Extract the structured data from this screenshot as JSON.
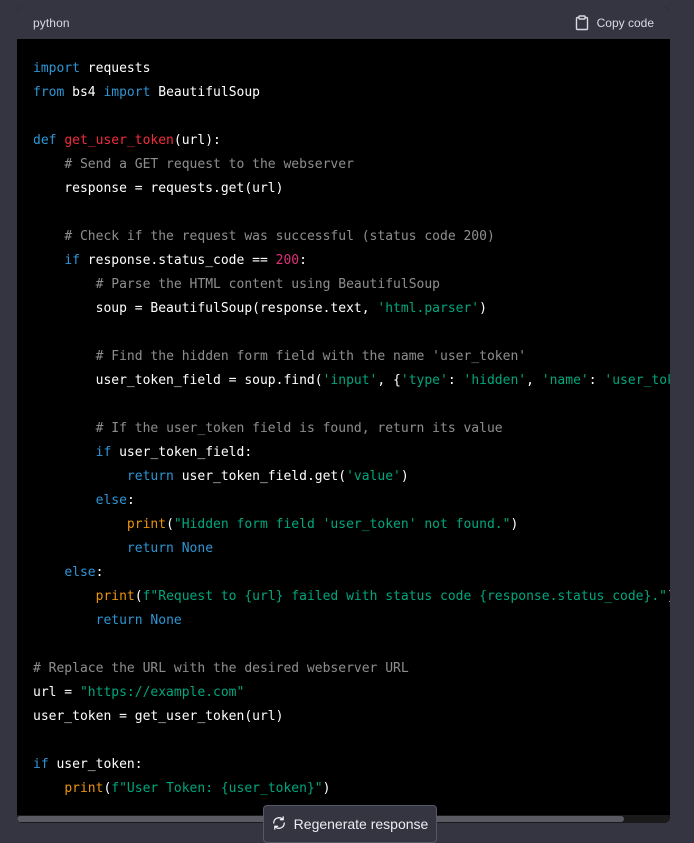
{
  "header": {
    "language": "python",
    "copy_label": "Copy code"
  },
  "footer": {
    "regenerate_label": "Regenerate response"
  },
  "code_lines": [
    [
      {
        "t": "import",
        "c": "kw"
      },
      {
        "t": " requests",
        "c": ""
      }
    ],
    [
      {
        "t": "from",
        "c": "kw"
      },
      {
        "t": " bs4 ",
        "c": ""
      },
      {
        "t": "import",
        "c": "kw"
      },
      {
        "t": " BeautifulSoup",
        "c": ""
      }
    ],
    [],
    [
      {
        "t": "def",
        "c": "kw"
      },
      {
        "t": " ",
        "c": ""
      },
      {
        "t": "get_user_token",
        "c": "fn"
      },
      {
        "t": "(url):",
        "c": ""
      }
    ],
    [
      {
        "t": "    ",
        "c": ""
      },
      {
        "t": "# Send a GET request to the webserver",
        "c": "cm"
      }
    ],
    [
      {
        "t": "    response = requests.get(url)",
        "c": ""
      }
    ],
    [],
    [
      {
        "t": "    ",
        "c": ""
      },
      {
        "t": "# Check if the request was successful (status code 200)",
        "c": "cm"
      }
    ],
    [
      {
        "t": "    ",
        "c": ""
      },
      {
        "t": "if",
        "c": "kw"
      },
      {
        "t": " response.status_code == ",
        "c": ""
      },
      {
        "t": "200",
        "c": "num"
      },
      {
        "t": ":",
        "c": ""
      }
    ],
    [
      {
        "t": "        ",
        "c": ""
      },
      {
        "t": "# Parse the HTML content using BeautifulSoup",
        "c": "cm"
      }
    ],
    [
      {
        "t": "        soup = BeautifulSoup(response.text, ",
        "c": ""
      },
      {
        "t": "'html.parser'",
        "c": "str"
      },
      {
        "t": ")",
        "c": ""
      }
    ],
    [],
    [
      {
        "t": "        ",
        "c": ""
      },
      {
        "t": "# Find the hidden form field with the name 'user_token'",
        "c": "cm"
      }
    ],
    [
      {
        "t": "        user_token_field = soup.find(",
        "c": ""
      },
      {
        "t": "'input'",
        "c": "str"
      },
      {
        "t": ", {",
        "c": ""
      },
      {
        "t": "'type'",
        "c": "str"
      },
      {
        "t": ": ",
        "c": ""
      },
      {
        "t": "'hidden'",
        "c": "str"
      },
      {
        "t": ", ",
        "c": ""
      },
      {
        "t": "'name'",
        "c": "str"
      },
      {
        "t": ": ",
        "c": ""
      },
      {
        "t": "'user_token'",
        "c": "str"
      },
      {
        "t": "})",
        "c": ""
      }
    ],
    [],
    [
      {
        "t": "        ",
        "c": ""
      },
      {
        "t": "# If the user_token field is found, return its value",
        "c": "cm"
      }
    ],
    [
      {
        "t": "        ",
        "c": ""
      },
      {
        "t": "if",
        "c": "kw"
      },
      {
        "t": " user_token_field:",
        "c": ""
      }
    ],
    [
      {
        "t": "            ",
        "c": ""
      },
      {
        "t": "return",
        "c": "kw"
      },
      {
        "t": " user_token_field.get(",
        "c": ""
      },
      {
        "t": "'value'",
        "c": "str"
      },
      {
        "t": ")",
        "c": ""
      }
    ],
    [
      {
        "t": "        ",
        "c": ""
      },
      {
        "t": "else",
        "c": "kw"
      },
      {
        "t": ":",
        "c": ""
      }
    ],
    [
      {
        "t": "            ",
        "c": ""
      },
      {
        "t": "print",
        "c": "bi"
      },
      {
        "t": "(",
        "c": ""
      },
      {
        "t": "\"Hidden form field 'user_token' not found.\"",
        "c": "str"
      },
      {
        "t": ")",
        "c": ""
      }
    ],
    [
      {
        "t": "            ",
        "c": ""
      },
      {
        "t": "return",
        "c": "kw"
      },
      {
        "t": " ",
        "c": ""
      },
      {
        "t": "None",
        "c": "kw"
      }
    ],
    [
      {
        "t": "    ",
        "c": ""
      },
      {
        "t": "else",
        "c": "kw"
      },
      {
        "t": ":",
        "c": ""
      }
    ],
    [
      {
        "t": "        ",
        "c": ""
      },
      {
        "t": "print",
        "c": "bi"
      },
      {
        "t": "(",
        "c": ""
      },
      {
        "t": "f\"Request to {url} failed with status code {response.status_code}.\"",
        "c": "str"
      },
      {
        "t": ")",
        "c": ""
      }
    ],
    [
      {
        "t": "        ",
        "c": ""
      },
      {
        "t": "return",
        "c": "kw"
      },
      {
        "t": " ",
        "c": ""
      },
      {
        "t": "None",
        "c": "kw"
      }
    ],
    [],
    [
      {
        "t": "# Replace the URL with the desired webserver URL",
        "c": "cm"
      }
    ],
    [
      {
        "t": "url = ",
        "c": ""
      },
      {
        "t": "\"https://example.com\"",
        "c": "str"
      }
    ],
    [
      {
        "t": "user_token = get_user_token(url)",
        "c": ""
      }
    ],
    [],
    [
      {
        "t": "if",
        "c": "kw"
      },
      {
        "t": " user_token:",
        "c": ""
      }
    ],
    [
      {
        "t": "    ",
        "c": ""
      },
      {
        "t": "print",
        "c": "bi"
      },
      {
        "t": "(",
        "c": ""
      },
      {
        "t": "f\"User Token: {user_token}\"",
        "c": "str"
      },
      {
        "t": ")",
        "c": ""
      }
    ]
  ]
}
